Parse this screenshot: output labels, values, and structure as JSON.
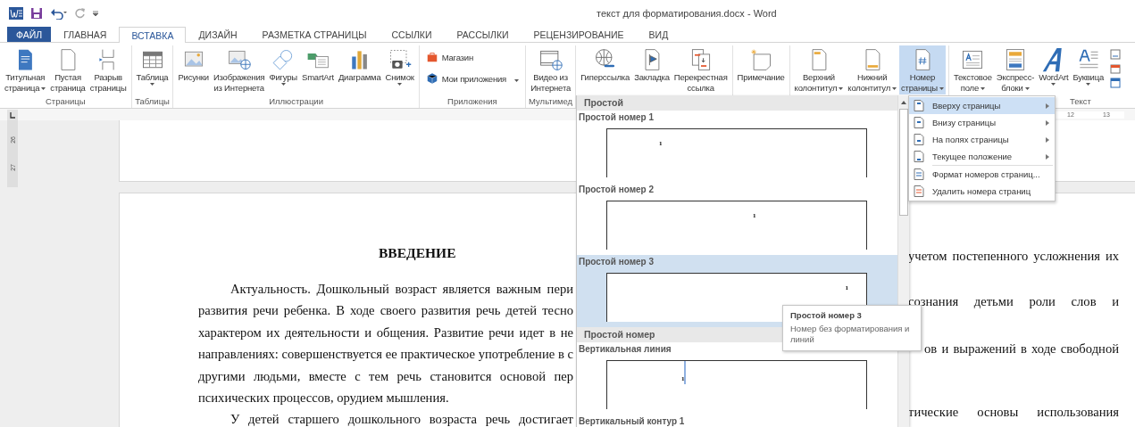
{
  "window": {
    "title": "текст для форматирования.docx - Word"
  },
  "tabs": [
    {
      "label": "ФАЙЛ",
      "kind": "file",
      "selected": false
    },
    {
      "label": "ГЛАВНАЯ",
      "kind": "tab",
      "selected": false
    },
    {
      "label": "ВСТАВКА",
      "kind": "tab",
      "selected": true
    },
    {
      "label": "ДИЗАЙН",
      "kind": "tab",
      "selected": false
    },
    {
      "label": "РАЗМЕТКА СТРАНИЦЫ",
      "kind": "tab",
      "selected": false
    },
    {
      "label": "ССЫЛКИ",
      "kind": "tab",
      "selected": false
    },
    {
      "label": "РАССЫЛКИ",
      "kind": "tab",
      "selected": false
    },
    {
      "label": "РЕЦЕНЗИРОВАНИЕ",
      "kind": "tab",
      "selected": false
    },
    {
      "label": "ВИД",
      "kind": "tab",
      "selected": false
    }
  ],
  "ribbon": {
    "groups": [
      {
        "label": "Страницы",
        "buttons": [
          {
            "kind": "large",
            "lines": [
              "Титульная",
              "страница"
            ],
            "dropdown": true,
            "pressed": false
          },
          {
            "kind": "large",
            "lines": [
              "Пустая",
              "страница"
            ],
            "dropdown": false,
            "pressed": false
          },
          {
            "kind": "large",
            "lines": [
              "Разрыв",
              "страницы"
            ],
            "dropdown": false,
            "pressed": false
          }
        ]
      },
      {
        "label": "Таблицы",
        "buttons": [
          {
            "kind": "large",
            "lines": [
              "Таблица"
            ],
            "dropdown": true,
            "pressed": false
          }
        ]
      },
      {
        "label": "Иллюстрации",
        "buttons": [
          {
            "kind": "large",
            "lines": [
              "Рисунки"
            ],
            "dropdown": false,
            "pressed": false
          },
          {
            "kind": "large",
            "lines": [
              "Изображения",
              "из Интернета"
            ],
            "dropdown": false,
            "pressed": false
          },
          {
            "kind": "large",
            "lines": [
              "Фигуры"
            ],
            "dropdown": true,
            "pressed": false
          },
          {
            "kind": "large",
            "lines": [
              "SmartArt"
            ],
            "dropdown": false,
            "pressed": false
          },
          {
            "kind": "large",
            "lines": [
              "Диаграмма"
            ],
            "dropdown": false,
            "pressed": false
          },
          {
            "kind": "large",
            "lines": [
              "Снимок"
            ],
            "dropdown": true,
            "pressed": false
          }
        ]
      },
      {
        "label": "Приложения",
        "buttons": [
          {
            "kind": "small",
            "lines": [
              "Магазин"
            ],
            "dropdown": false,
            "pressed": false
          },
          {
            "kind": "small",
            "lines": [
              "Мои приложения"
            ],
            "dropdown": true,
            "pressed": false
          }
        ]
      },
      {
        "label": "Мультимед",
        "buttons": [
          {
            "kind": "large",
            "lines": [
              "Видео из",
              "Интернета"
            ],
            "dropdown": false,
            "pressed": false
          }
        ]
      },
      {
        "buttons": [
          {
            "kind": "large",
            "lines": [
              "Гиперссылка"
            ],
            "dropdown": false,
            "pressed": false
          },
          {
            "kind": "large",
            "lines": [
              "Закладка"
            ],
            "dropdown": false,
            "pressed": false
          },
          {
            "kind": "large",
            "lines": [
              "Перекрестная",
              "ссылка"
            ],
            "dropdown": false,
            "pressed": false
          }
        ]
      },
      {
        "buttons": [
          {
            "kind": "large",
            "lines": [
              "Примечание"
            ],
            "dropdown": false,
            "pressed": false
          }
        ]
      },
      {
        "buttons": [
          {
            "kind": "large",
            "lines": [
              "Верхний",
              "колонтитул"
            ],
            "dropdown": true,
            "pressed": false
          },
          {
            "kind": "large",
            "lines": [
              "Нижний",
              "колонтитул"
            ],
            "dropdown": true,
            "pressed": false
          },
          {
            "kind": "large",
            "lines": [
              "Номер",
              "страницы"
            ],
            "dropdown": true,
            "pressed": true
          }
        ]
      },
      {
        "label": "Текст",
        "buttons": [
          {
            "kind": "large",
            "lines": [
              "Текстовое",
              "поле"
            ],
            "dropdown": true,
            "pressed": false
          },
          {
            "kind": "large",
            "lines": [
              "Экспресс-",
              "блоки"
            ],
            "dropdown": true,
            "pressed": false
          },
          {
            "kind": "large",
            "lines": [
              "WordArt"
            ],
            "dropdown": true,
            "pressed": false
          },
          {
            "kind": "large",
            "lines": [
              "Буквица"
            ],
            "dropdown": true,
            "pressed": false
          }
        ]
      }
    ]
  },
  "ruler": {
    "horizontal": [
      "12",
      "13"
    ],
    "vertical": [
      "26",
      "27"
    ]
  },
  "document": {
    "heading": "ВВЕДЕНИЕ",
    "left_lines": [
      {
        "text": "Актуальность. Дошкольный возраст является важным пери",
        "kind": "first"
      },
      {
        "text": "развития речи ребенка. В ходе своего развития речь детей тесно",
        "kind": "middle"
      },
      {
        "text": "характером их деятельности и общения. Развитие речи идет в не",
        "kind": "middle"
      },
      {
        "text": "направлениях: совершенствуется ее практическое употребление в с",
        "kind": "middle"
      },
      {
        "text": "другими людьми, вместе с тем речь становится основой пер",
        "kind": "middle"
      },
      {
        "text": "психических процессов, орудием мышления.",
        "kind": "last"
      },
      {
        "text": "У детей старшего дошкольного возраста речь достигает",
        "kind": "first"
      }
    ],
    "right_lines": [
      "учетом постепенного усложнения их",
      "сознания детьми роли слов и",
      "ов и выражений в ходе свободной",
      "тические основы использования"
    ]
  },
  "gallery": {
    "sections": [
      {
        "title": "Простой",
        "items": [
          {
            "title": "Простой номер 1",
            "number": "1",
            "kind": "left",
            "selected": false
          },
          {
            "title": "Простой номер 2",
            "number": "1",
            "kind": "center",
            "selected": false
          },
          {
            "title": "Простой номер 3",
            "number": "1",
            "kind": "right",
            "selected": true
          }
        ]
      },
      {
        "title": "Простой номер",
        "items": [
          {
            "title": "Вертикальная линия",
            "number": "1",
            "kind": "line",
            "selected": false
          },
          {
            "title": "Вертикальный контур 1",
            "selected": false
          }
        ]
      }
    ]
  },
  "submenu": [
    {
      "label": "Вверху страницы",
      "kind": "position",
      "selected": true
    },
    {
      "label": "Внизу страницы",
      "kind": "position",
      "selected": false
    },
    {
      "label": "На полях страницы",
      "kind": "position",
      "selected": false
    },
    {
      "label": "Текущее положение",
      "kind": "position",
      "selected": false
    },
    {
      "label": "Формат номеров страниц...",
      "kind": "command",
      "selected": false
    },
    {
      "label": "Удалить номера страниц",
      "kind": "command",
      "selected": false
    }
  ],
  "tooltip": {
    "title": "Простой номер 3",
    "text": "Номер без форматирования и линий"
  }
}
